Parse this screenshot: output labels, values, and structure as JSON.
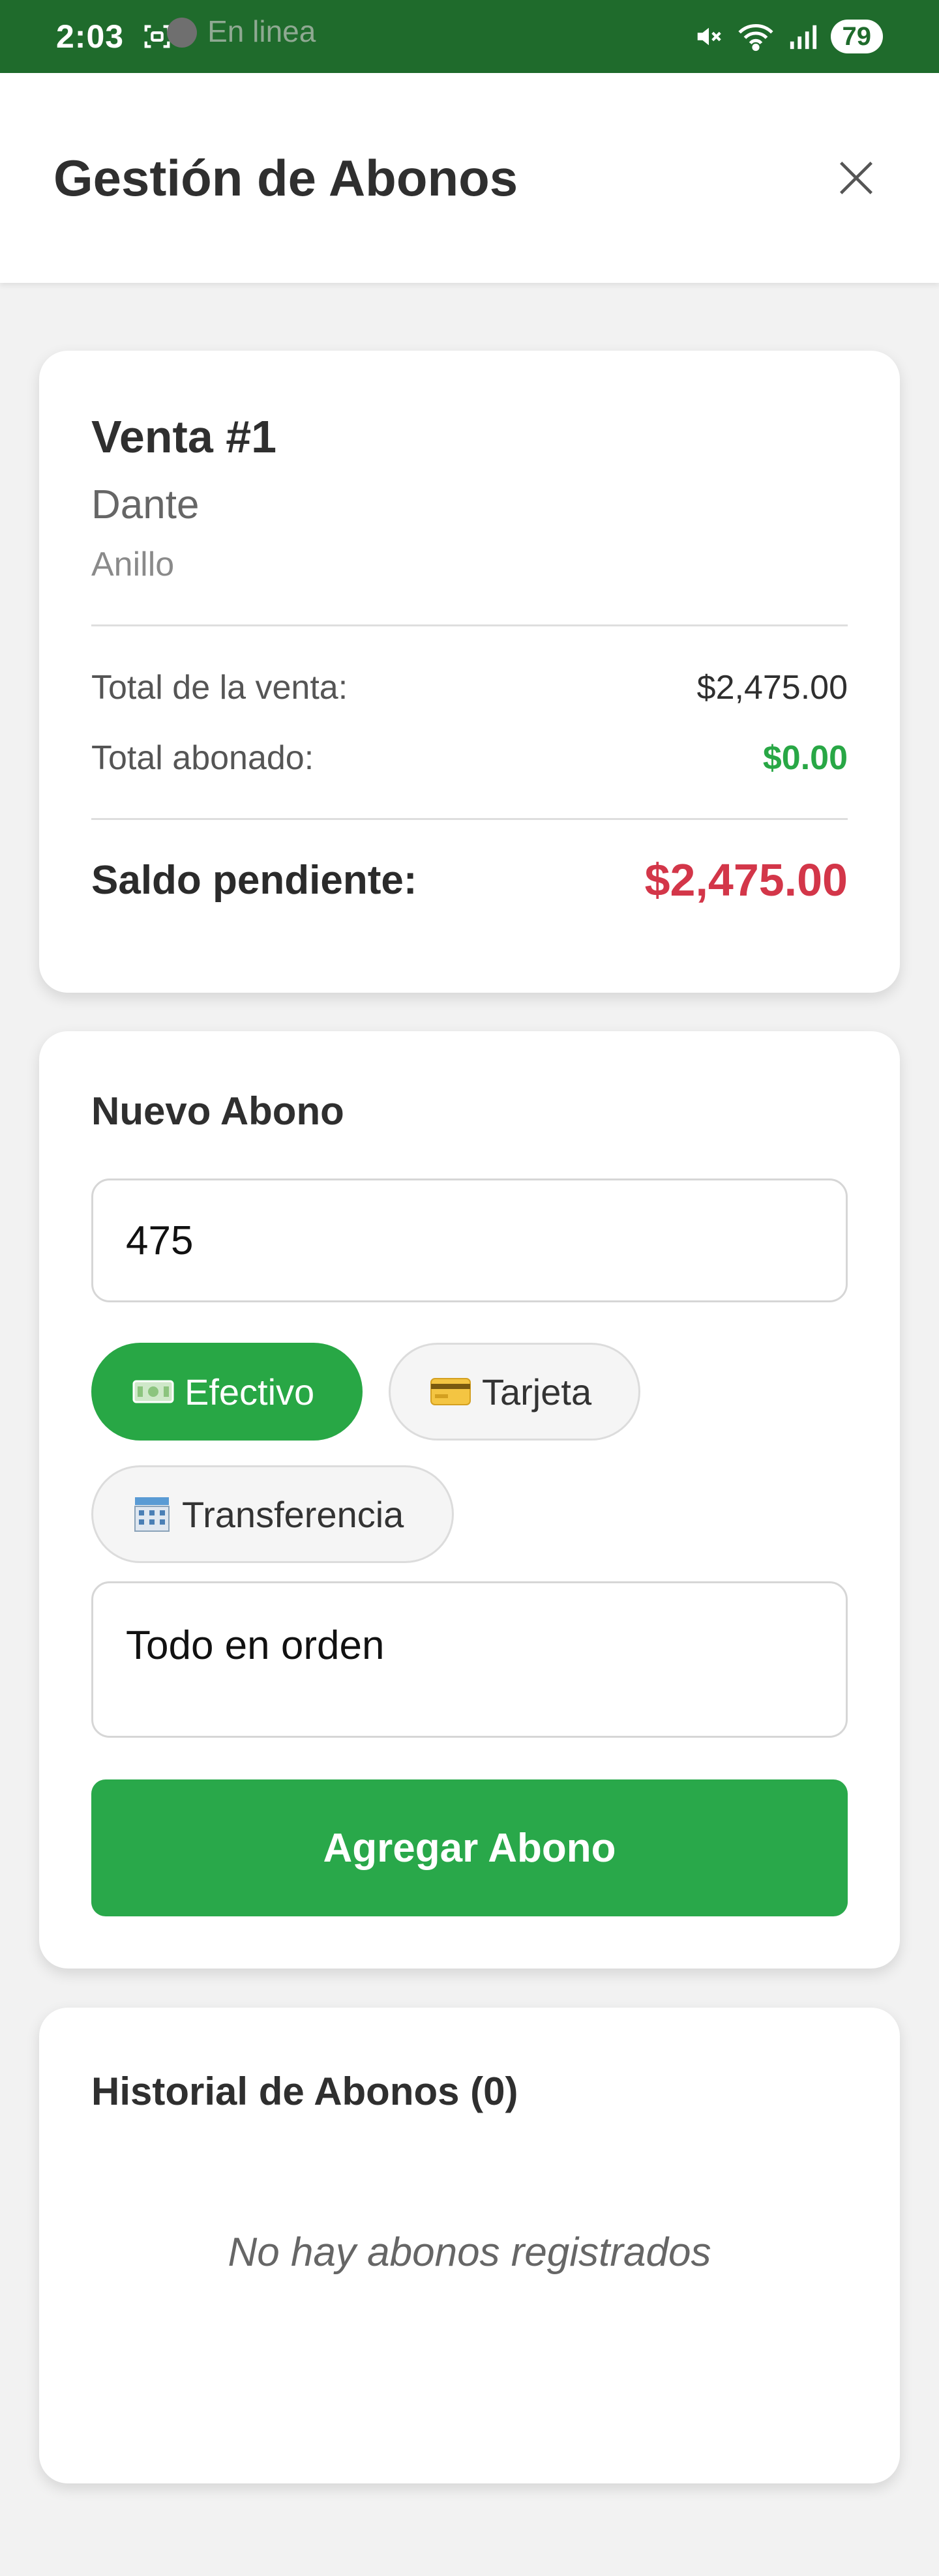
{
  "status_bar": {
    "time": "2:03",
    "online_label": "En linea",
    "battery": "79"
  },
  "header": {
    "title": "Gestión de Abonos"
  },
  "sale": {
    "title": "Venta #1",
    "client": "Dante",
    "product": "Anillo",
    "total_label": "Total de la venta:",
    "total_value": "$2,475.00",
    "paid_label": "Total abonado:",
    "paid_value": "$0.00",
    "balance_label": "Saldo pendiente:",
    "balance_value": "$2,475.00"
  },
  "new_payment": {
    "title": "Nuevo Abono",
    "amount_value": "475",
    "methods": [
      {
        "label": "Efectivo",
        "icon": "money-icon",
        "selected": true
      },
      {
        "label": "Tarjeta",
        "icon": "credit-card-icon",
        "selected": false
      },
      {
        "label": "Transferencia",
        "icon": "bank-icon",
        "selected": false
      }
    ],
    "notes_value": "Todo en orden",
    "submit_label": "Agregar Abono"
  },
  "history": {
    "title": "Historial de Abonos (0)",
    "empty_message": "No hay abonos registrados"
  },
  "colors": {
    "status_bar": "#1f6b2c",
    "accent_green": "#28a745",
    "balance_red": "#d33649"
  }
}
